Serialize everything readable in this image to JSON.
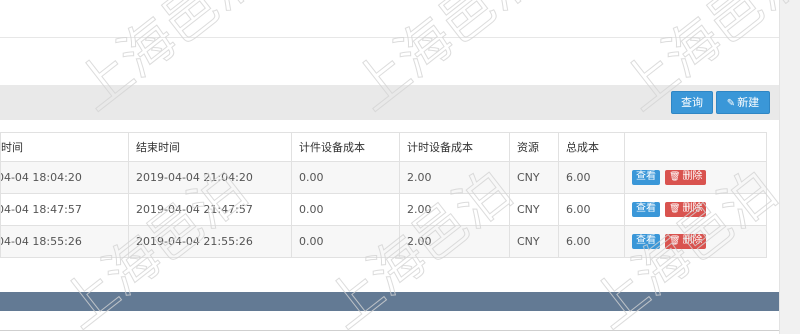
{
  "toolbar": {
    "query_label": "查询",
    "new_label": "新建"
  },
  "table": {
    "headers": [
      "时间",
      "结束时间",
      "计件设备成本",
      "计时设备成本",
      "资源",
      "总成本",
      ""
    ],
    "rows": [
      {
        "start": "-04-04 18:04:20",
        "end": "2019-04-04 21:04:20",
        "piece_cost": "0.00",
        "time_cost": "2.00",
        "resource": "CNY",
        "total": "6.00"
      },
      {
        "start": "-04-04 18:47:57",
        "end": "2019-04-04 21:47:57",
        "piece_cost": "0.00",
        "time_cost": "2.00",
        "resource": "CNY",
        "total": "6.00"
      },
      {
        "start": "-04-04 18:55:26",
        "end": "2019-04-04 21:55:26",
        "piece_cost": "0.00",
        "time_cost": "2.00",
        "resource": "CNY",
        "total": "6.00"
      }
    ],
    "view_label": "查看",
    "delete_label": "删除"
  },
  "watermark_text": "上海邑泊",
  "colors": {
    "primary": "#3a97d8",
    "danger": "#d9534f",
    "footer": "#637a94",
    "toolbar_bg": "#e9e9e9"
  },
  "icons": {
    "new": "pencil-icon",
    "delete": "trash-icon"
  }
}
